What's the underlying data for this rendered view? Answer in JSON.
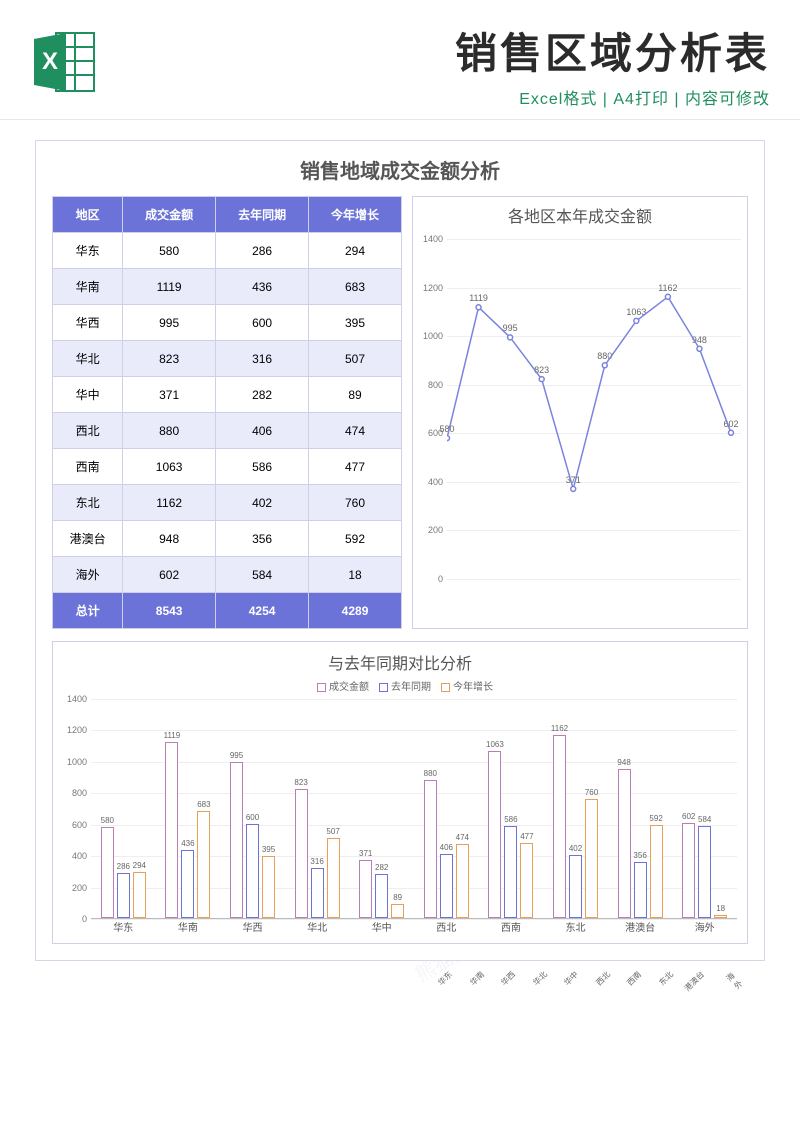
{
  "header": {
    "title": "销售区域分析表",
    "subtitle": "Excel格式 | A4打印 | 内容可修改"
  },
  "page_title": "销售地域成交金额分析",
  "watermark": "熊猫办公 www.tukuppt.com",
  "table": {
    "headers": [
      "地区",
      "成交金额",
      "去年同期",
      "今年增长"
    ],
    "rows": [
      {
        "region": "华东",
        "amount": 580,
        "last": 286,
        "growth": 294
      },
      {
        "region": "华南",
        "amount": 1119,
        "last": 436,
        "growth": 683
      },
      {
        "region": "华西",
        "amount": 995,
        "last": 600,
        "growth": 395
      },
      {
        "region": "华北",
        "amount": 823,
        "last": 316,
        "growth": 507
      },
      {
        "region": "华中",
        "amount": 371,
        "last": 282,
        "growth": 89
      },
      {
        "region": "西北",
        "amount": 880,
        "last": 406,
        "growth": 474
      },
      {
        "region": "西南",
        "amount": 1063,
        "last": 586,
        "growth": 477
      },
      {
        "region": "东北",
        "amount": 1162,
        "last": 402,
        "growth": 760
      },
      {
        "region": "港澳台",
        "amount": 948,
        "last": 356,
        "growth": 592
      },
      {
        "region": "海外",
        "amount": 602,
        "last": 584,
        "growth": 18
      }
    ],
    "footer": {
      "label": "总计",
      "amount": 8543,
      "last": 4254,
      "growth": 4289
    }
  },
  "chart_data": [
    {
      "type": "line",
      "title": "各地区本年成交金额",
      "categories": [
        "华东",
        "华南",
        "华西",
        "华北",
        "华中",
        "西北",
        "西南",
        "东北",
        "港澳台",
        "海外"
      ],
      "values": [
        580,
        1119,
        995,
        823,
        371,
        880,
        1063,
        1162,
        948,
        602
      ],
      "ylim": [
        0,
        1400
      ],
      "yticks": [
        0,
        200,
        400,
        600,
        800,
        1000,
        1200,
        1400
      ],
      "line_color": "#7a83de"
    },
    {
      "type": "bar",
      "title": "与去年同期对比分析",
      "categories": [
        "华东",
        "华南",
        "华西",
        "华北",
        "华中",
        "西北",
        "西南",
        "东北",
        "港澳台",
        "海外"
      ],
      "series": [
        {
          "name": "成交金额",
          "color": "#b77fb4",
          "values": [
            580,
            1119,
            995,
            823,
            371,
            880,
            1063,
            1162,
            948,
            602
          ]
        },
        {
          "name": "去年同期",
          "color": "#6b73d9",
          "values": [
            286,
            436,
            600,
            316,
            282,
            406,
            586,
            402,
            356,
            584
          ]
        },
        {
          "name": "今年增长",
          "color": "#e6a05a",
          "values": [
            294,
            683,
            395,
            507,
            89,
            474,
            477,
            760,
            592,
            18
          ]
        }
      ],
      "ylim": [
        0,
        1400
      ],
      "yticks": [
        0,
        200,
        400,
        600,
        800,
        1000,
        1200,
        1400
      ]
    }
  ]
}
